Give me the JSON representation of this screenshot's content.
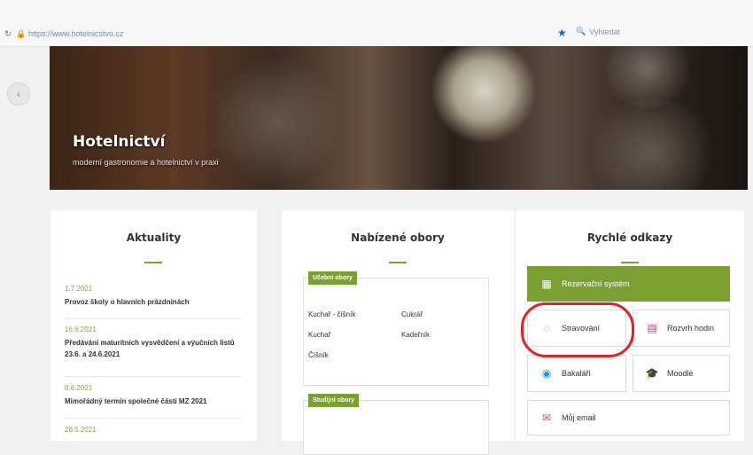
{
  "browser": {
    "url": "https://www.hotelnicstvo.cz",
    "search_placeholder": "Vyhledat"
  },
  "hero": {
    "title": "Hotelnictví",
    "subtitle": "moderní gastronomie a hotelnictví v praxi"
  },
  "news": {
    "title": "Aktuality",
    "items": [
      {
        "date": "1.7.2021",
        "title": "Provoz školy o hlavních prázdninách"
      },
      {
        "date": "16.6.2021",
        "title": "Předávání maturitních vysvědčení a výučních listů 23.6. a 24.6.2021"
      },
      {
        "date": "8.6.2021",
        "title": "Mimořádný termín společné části MZ 2021"
      },
      {
        "date": "28.5.2021",
        "title": ""
      }
    ]
  },
  "fields": {
    "title": "Nabízené obory",
    "group1_label": "Učební obory",
    "group1_items": [
      "Kuchař - číšník",
      "Cukrář",
      "Kuchař",
      "Kadeřník",
      "Číšník"
    ],
    "group2_label": "Studijní obory"
  },
  "quick": {
    "title": "Rychlé odkazy",
    "links": [
      {
        "label": "Rezervační systém",
        "icon": "calendar-icon"
      },
      {
        "label": "Stravování",
        "icon": "plate-icon"
      },
      {
        "label": "Rozvrh hodin",
        "icon": "timetable-icon"
      },
      {
        "label": "Bakaláři",
        "icon": "bakalari-icon"
      },
      {
        "label": "Moodle",
        "icon": "graduation-cap-icon"
      },
      {
        "label": "Můj email",
        "icon": "envelope-icon"
      }
    ]
  },
  "colors": {
    "accent": "#7aa031",
    "highlight_circle": "#e02323",
    "star": "#1a5bd6"
  }
}
